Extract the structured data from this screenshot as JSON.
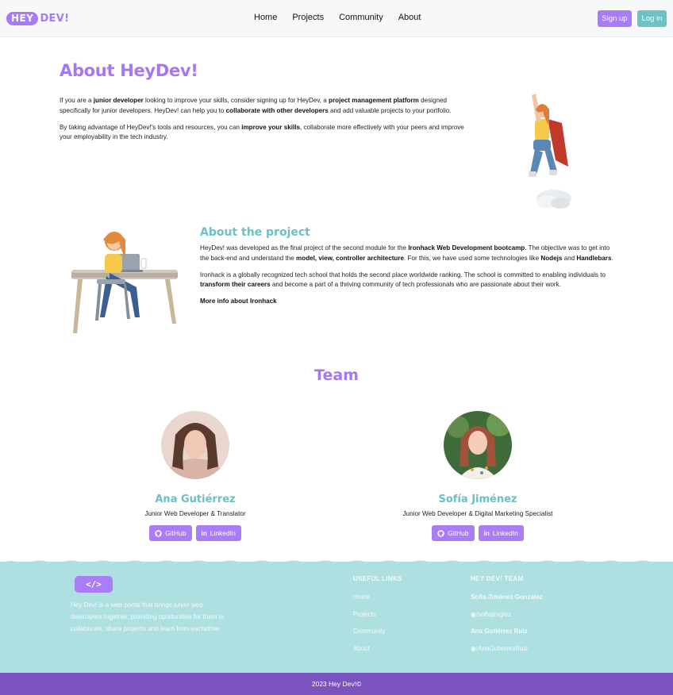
{
  "navbar": {
    "logo_hey": "HEY",
    "logo_dev": "DEV!",
    "links": [
      "Home",
      "Projects",
      "Community",
      "About"
    ],
    "signup_label": "Sign up",
    "login_label": "Log in"
  },
  "about": {
    "title": "About HeyDev!",
    "p1_parts": [
      "If you are a ",
      "junior developer",
      " looking to improve your skills, consider signing up for HeyDev, a ",
      "project management platform",
      " designed specifically for junior developers. HeyDev! can help you to ",
      "collaborate with other developers",
      " and add valuable projects to your portfolio."
    ],
    "p2_parts": [
      "By taking advantage of HeyDev!'s tools and resources, you can ",
      "improve your skills",
      ", collaborate more effectively with your peers and improve your employability in the tech industry."
    ]
  },
  "project": {
    "title": "About the project",
    "p1_parts": [
      "HeyDev! was developed as the final project of the second module for the ",
      "Ironhack Web Development bootcamp",
      ". The objective was to get into the back-end and understand the ",
      "model, view, controller architecture",
      ". For this, we have used some technologies like ",
      "Nodejs",
      " and ",
      "Handlebars",
      "."
    ],
    "p2_parts": [
      "Ironhack is a globally recognized tech school that holds the second place worldwide ranking. The school is committed to enabling individuals to ",
      "transform their careers",
      " and become a part of a thriving community of tech professionals who are passionate about their work."
    ],
    "more_link": "More info about Ironhack"
  },
  "team": {
    "title": "Team",
    "members": [
      {
        "name": "Ana Gutiérrez",
        "role": "Junior Web Developer & Translator",
        "github": "GitHub",
        "linkedin": "LinkedIn"
      },
      {
        "name": "Sofía Jiménez",
        "role": "Junior Web Developer & Digital Marketing Specialist",
        "github": "GitHub",
        "linkedin": "LinkedIn"
      }
    ]
  },
  "footer": {
    "logo": "</>",
    "description": "Hey Dev! is a web portal that brings junior web developers together, providing oportunities for them to collaborate, share projects and learn from eachother.",
    "useful_links_title": "USEFUL LINKS",
    "useful_links": [
      "Home",
      "Projects",
      "Community",
      "About"
    ],
    "team_title": "HEY DEV! TEAM",
    "team_items": [
      "Sofía Jiménez González",
      "/sofiajimglez",
      "Ana Gutiérrez Ruiz",
      "/AnaGutierrezRuiz"
    ],
    "copyright": "2023 Hey Dev!©"
  },
  "colors": {
    "purple": "#a87df5",
    "teal": "#6cc0c4",
    "footer_bg": "#aee0e1",
    "bottom_bar": "#7a53be"
  },
  "icons": [
    "github-icon",
    "linkedin-icon",
    "code-icon"
  ]
}
